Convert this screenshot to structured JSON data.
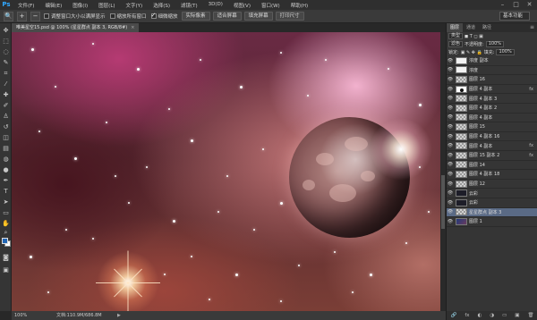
{
  "app": {
    "logo": "Ps"
  },
  "menu": [
    "文件(F)",
    "编辑(E)",
    "图像(I)",
    "图层(L)",
    "文字(Y)",
    "选择(S)",
    "滤镜(T)",
    "3D(D)",
    "视图(V)",
    "窗口(W)",
    "帮助(H)"
  ],
  "window_controls": [
    "–",
    "□",
    "✕"
  ],
  "options_bar": {
    "zoom_icon": "🔍",
    "checks": [
      {
        "label": "调整窗口大小以满屏显示",
        "checked": false
      },
      {
        "label": "缩放所有窗口",
        "checked": false
      },
      {
        "label": "细微缩放",
        "checked": true
      }
    ],
    "buttons": [
      "实际像素",
      "适合屏幕",
      "填充屏幕",
      "打印尺寸"
    ],
    "workspace": "基本功能"
  },
  "document": {
    "tab_title": "唯美星空15.psd @ 100% (星星群点 副本 3, RGB/8#)",
    "tab_close": "×"
  },
  "status": {
    "zoom": "100%",
    "doc_size": "文档:110.9M/686.8M",
    "arrow": "▶"
  },
  "panel": {
    "tabs": [
      "图层",
      "通道",
      "路径"
    ],
    "menu_icon": "≡",
    "kind_row": {
      "kind": "类型",
      "icons": "◼ T ◻ ▣"
    },
    "blend_row": {
      "mode": "滤色",
      "opacity_label": "不透明度:",
      "opacity": "100%"
    },
    "lock_row": {
      "lock_label": "锁定:",
      "fill_label": "填充:",
      "fill": "100%"
    },
    "layers": [
      {
        "name": "浓度 副本",
        "thumb": "white",
        "visible": true,
        "fx": false,
        "selected": false
      },
      {
        "name": "浓度",
        "thumb": "white",
        "visible": true,
        "fx": false,
        "selected": false
      },
      {
        "name": "图层 16",
        "thumb": "checker",
        "visible": true,
        "fx": false,
        "selected": false
      },
      {
        "name": "图层 4 副本",
        "thumb": "mask",
        "visible": true,
        "fx": true,
        "selected": false
      },
      {
        "name": "图层 4 副本 3",
        "thumb": "checker",
        "visible": true,
        "fx": false,
        "selected": false
      },
      {
        "name": "图层 4 副本 2",
        "thumb": "checker",
        "visible": true,
        "fx": false,
        "selected": false
      },
      {
        "name": "图层 4 副本",
        "thumb": "checker",
        "visible": true,
        "fx": false,
        "selected": false
      },
      {
        "name": "图层 15",
        "thumb": "checker",
        "visible": true,
        "fx": false,
        "selected": false
      },
      {
        "name": "图层 4 副本 16",
        "thumb": "checker",
        "visible": true,
        "fx": false,
        "selected": false
      },
      {
        "name": "图层 4 副本",
        "thumb": "checker",
        "visible": true,
        "fx": true,
        "selected": false
      },
      {
        "name": "图层 15 副本 2",
        "thumb": "checker",
        "visible": true,
        "fx": true,
        "selected": false
      },
      {
        "name": "图层 14",
        "thumb": "checker",
        "visible": true,
        "fx": false,
        "selected": false
      },
      {
        "name": "图层 4 副本 18",
        "thumb": "checker",
        "visible": true,
        "fx": false,
        "selected": false
      },
      {
        "name": "图层 12",
        "thumb": "checker",
        "visible": true,
        "fx": false,
        "selected": false
      },
      {
        "name": "云彩",
        "thumb": "dark",
        "visible": true,
        "fx": false,
        "selected": false
      },
      {
        "name": "云彩",
        "thumb": "dark",
        "visible": true,
        "fx": false,
        "selected": false
      },
      {
        "name": "星星群点 副本 3",
        "thumb": "checker",
        "visible": true,
        "fx": false,
        "selected": true
      },
      {
        "name": "图层 1",
        "thumb": "blue",
        "visible": true,
        "fx": false,
        "selected": false
      }
    ],
    "bottom_icons": [
      "🔗",
      "fx",
      "◐",
      "◑",
      "▭",
      "▣",
      "🗑"
    ]
  },
  "colors": {
    "foreground": "#2367b5",
    "background": "#ffffff",
    "selected_layer": "#5a6a85"
  }
}
